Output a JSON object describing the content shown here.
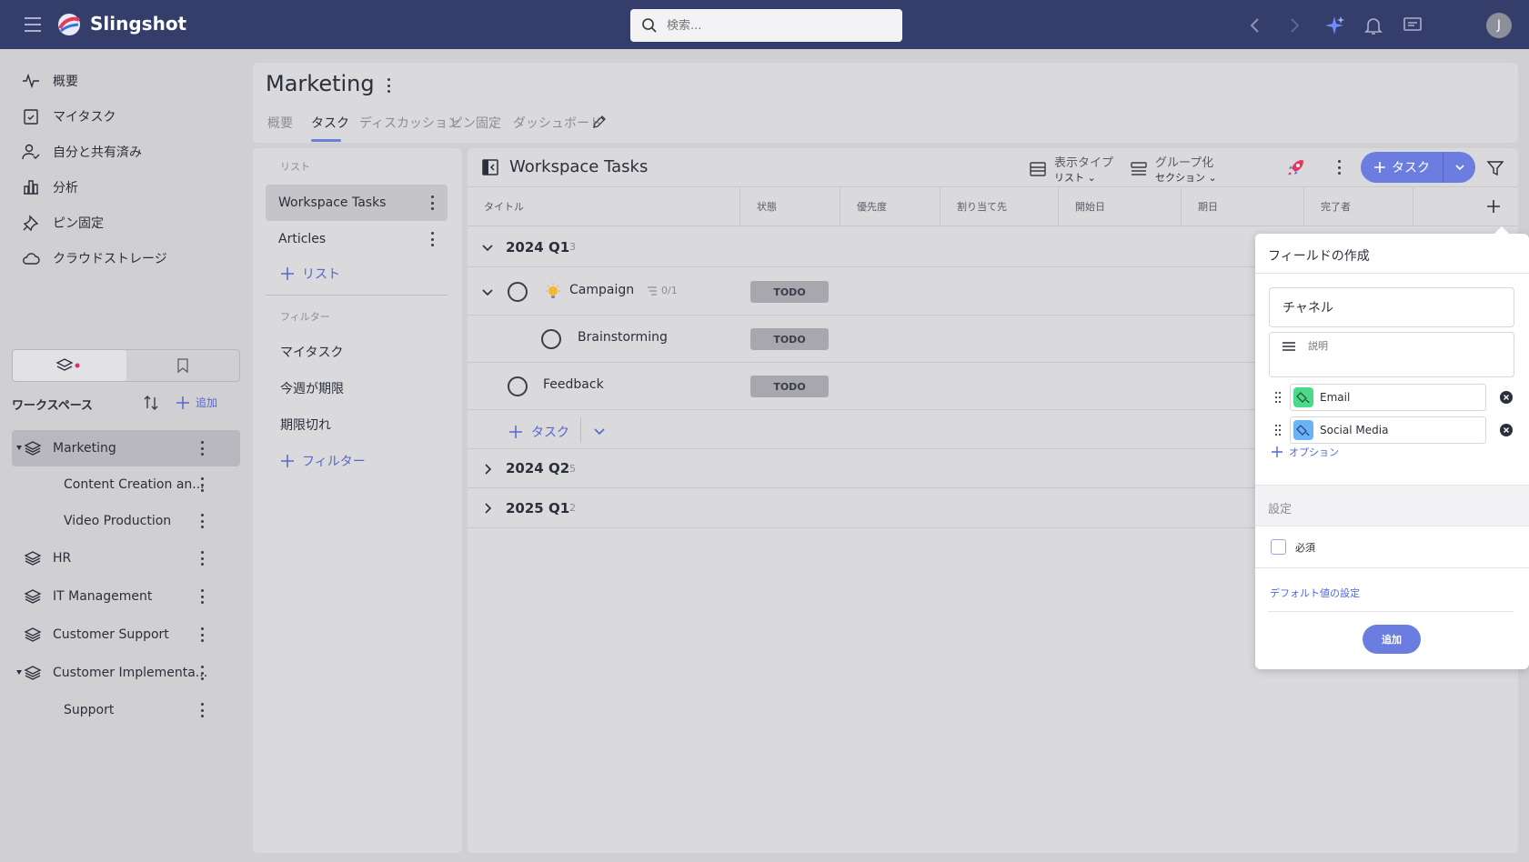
{
  "topbar": {
    "brand": "Slingshot",
    "search_placeholder": "検索...",
    "avatar_initial": "J"
  },
  "sidebar": {
    "nav": [
      {
        "label": "概要",
        "icon": "activity-icon"
      },
      {
        "label": "マイタスク",
        "icon": "clipboard-check-icon"
      },
      {
        "label": "自分と共有済み",
        "icon": "user-check-icon"
      },
      {
        "label": "分析",
        "icon": "bar-chart-icon"
      },
      {
        "label": "ピン固定",
        "icon": "pin-icon"
      },
      {
        "label": "クラウドストレージ",
        "icon": "cloud-icon"
      }
    ],
    "workspace_title": "ワークスペース",
    "add_label": "追加",
    "workspaces": [
      {
        "label": "Marketing",
        "active": true
      },
      {
        "label": "Content Creation an..."
      },
      {
        "label": "Video Production"
      },
      {
        "label": "HR"
      },
      {
        "label": "IT Management"
      },
      {
        "label": "Customer Support"
      },
      {
        "label": "Customer Implementa..."
      },
      {
        "label": "Support"
      }
    ]
  },
  "project": {
    "title": "Marketing",
    "tabs": [
      "概要",
      "タスク",
      "ディスカッション",
      "ピン固定",
      "ダッシュボード"
    ],
    "active_tab": "タスク"
  },
  "lists_panel": {
    "list_section": "リスト",
    "lists": [
      "Workspace Tasks",
      "Articles"
    ],
    "add_list": "リスト",
    "filter_section": "フィルター",
    "filters": [
      "マイタスク",
      "今週が期限",
      "期限切れ"
    ],
    "add_filter": "フィルター"
  },
  "main": {
    "title": "Workspace Tasks",
    "view_type": {
      "label": "表示タイプ",
      "value": "リスト"
    },
    "grouping": {
      "label": "グループ化",
      "value": "セクション"
    },
    "task_button": "タスク",
    "columns": [
      "タイトル",
      "状態",
      "優先度",
      "割り当て先",
      "開始日",
      "期日",
      "完了者"
    ],
    "groups": [
      {
        "name": "2024 Q1",
        "count": "3",
        "expanded": true
      },
      {
        "name": "2024 Q2",
        "count": "5",
        "expanded": false
      },
      {
        "name": "2025 Q1",
        "count": "2",
        "expanded": false
      }
    ],
    "tasks": [
      {
        "title": "Campaign",
        "status": "TODO",
        "subtasks": "0/1"
      },
      {
        "title": "Brainstorming",
        "status": "TODO"
      },
      {
        "title": "Feedback",
        "status": "TODO"
      }
    ],
    "add_task": "タスク"
  },
  "popup": {
    "title": "フィールドの作成",
    "field_name": "チャネル",
    "description_placeholder": "説明",
    "options": [
      {
        "label": "Email",
        "color": "#4cd98a"
      },
      {
        "label": "Social Media",
        "color": "#6ab4f5"
      }
    ],
    "add_option": "オプション",
    "settings_label": "設定",
    "required_label": "必須",
    "default_value_link": "デフォルト値の設定",
    "add_button": "追加"
  },
  "colors": {
    "topbar": "#353d6b",
    "accent": "#6c7de0",
    "todo_badge": "#a7a7ad"
  }
}
